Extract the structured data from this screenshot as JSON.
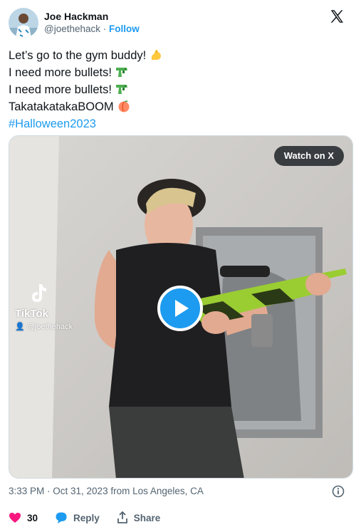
{
  "tweet": {
    "author_name": "Joe Hackman",
    "author_handle": "@joethehack",
    "separator": " · ",
    "follow_label": "Follow",
    "lines": [
      {
        "text": "Let’s go to the gym buddy!",
        "emoji": "flexed-biceps-emoji"
      },
      {
        "text": "I need more bullets!",
        "emoji": "water-pistol-emoji"
      },
      {
        "text": "I need more bullets!",
        "emoji": "water-pistol-emoji"
      },
      {
        "text": "TakatakatakaBOOM",
        "emoji": "peach-emoji"
      }
    ],
    "hashtag": "#Halloween2023"
  },
  "media": {
    "watch_label": "Watch on X",
    "play_icon": "play-icon",
    "tiktok_label": "TikTok",
    "tiktok_handle": "@joethehack"
  },
  "meta": {
    "timestamp": "3:33 PM · Oct 31, 2023 from Los Angeles, CA",
    "info_icon": "info-icon"
  },
  "actions": {
    "like_count": "30",
    "reply_label": "Reply",
    "share_label": "Share"
  },
  "colors": {
    "accent": "#1d9bf0",
    "like": "#f91880",
    "text": "#0f1419",
    "muted": "#536471"
  }
}
